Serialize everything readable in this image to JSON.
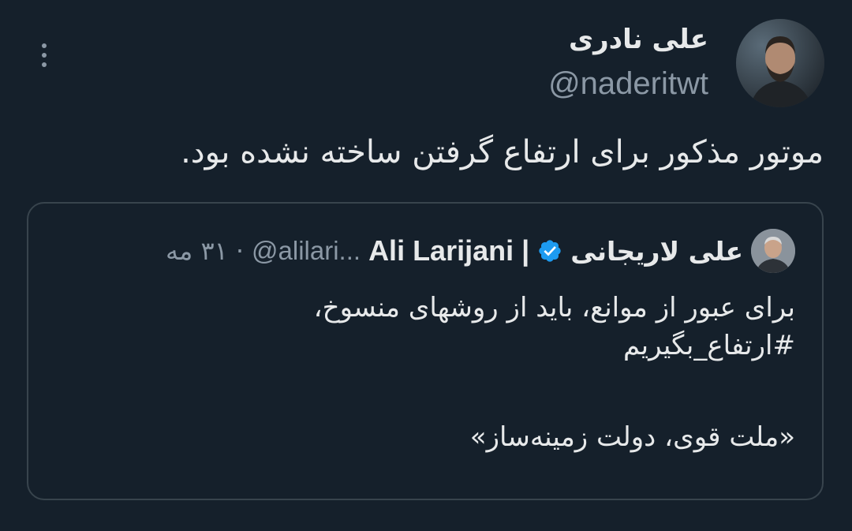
{
  "author": {
    "display_name": "علی نادری",
    "handle": "@naderitwt"
  },
  "tweet": {
    "text": "موتور مذکور برای ارتفاع گرفتن ساخته نشده بود."
  },
  "quoted_tweet": {
    "display_name": "علی لاریجانی",
    "display_name_en": "Ali Larijani |",
    "handle": "@alilari...",
    "separator": "·",
    "date": "۳۱ مه",
    "line1": "برای عبور از موانع، باید از روشهای منسوخ،",
    "hashtag": "#ارتفاع_بگیریم",
    "line3": "«ملت قوی، دولت زمینه‌ساز»"
  },
  "colors": {
    "background": "#15202b",
    "text": "#e7e9ea",
    "muted": "#8b98a5",
    "border": "#38444d",
    "verified": "#1d9bf0"
  },
  "icons": {
    "more": "more-vertical-icon",
    "verified": "verified-badge-icon"
  }
}
